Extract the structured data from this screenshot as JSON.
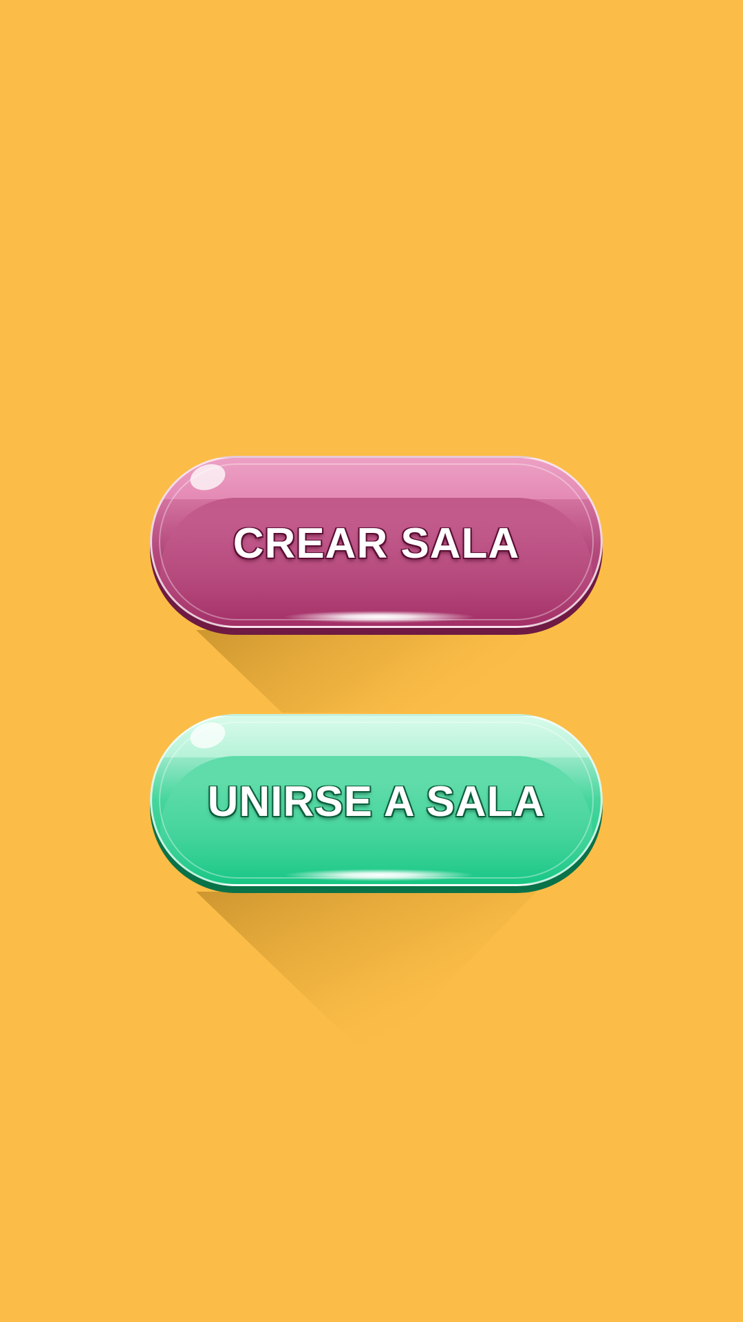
{
  "background_color": "#FBBD47",
  "buttons": {
    "create_room": {
      "label": "CREAR SALA",
      "color": "#A02C63"
    },
    "join_room": {
      "label": "UNIRSE A SALA",
      "color": "#12C581"
    }
  }
}
